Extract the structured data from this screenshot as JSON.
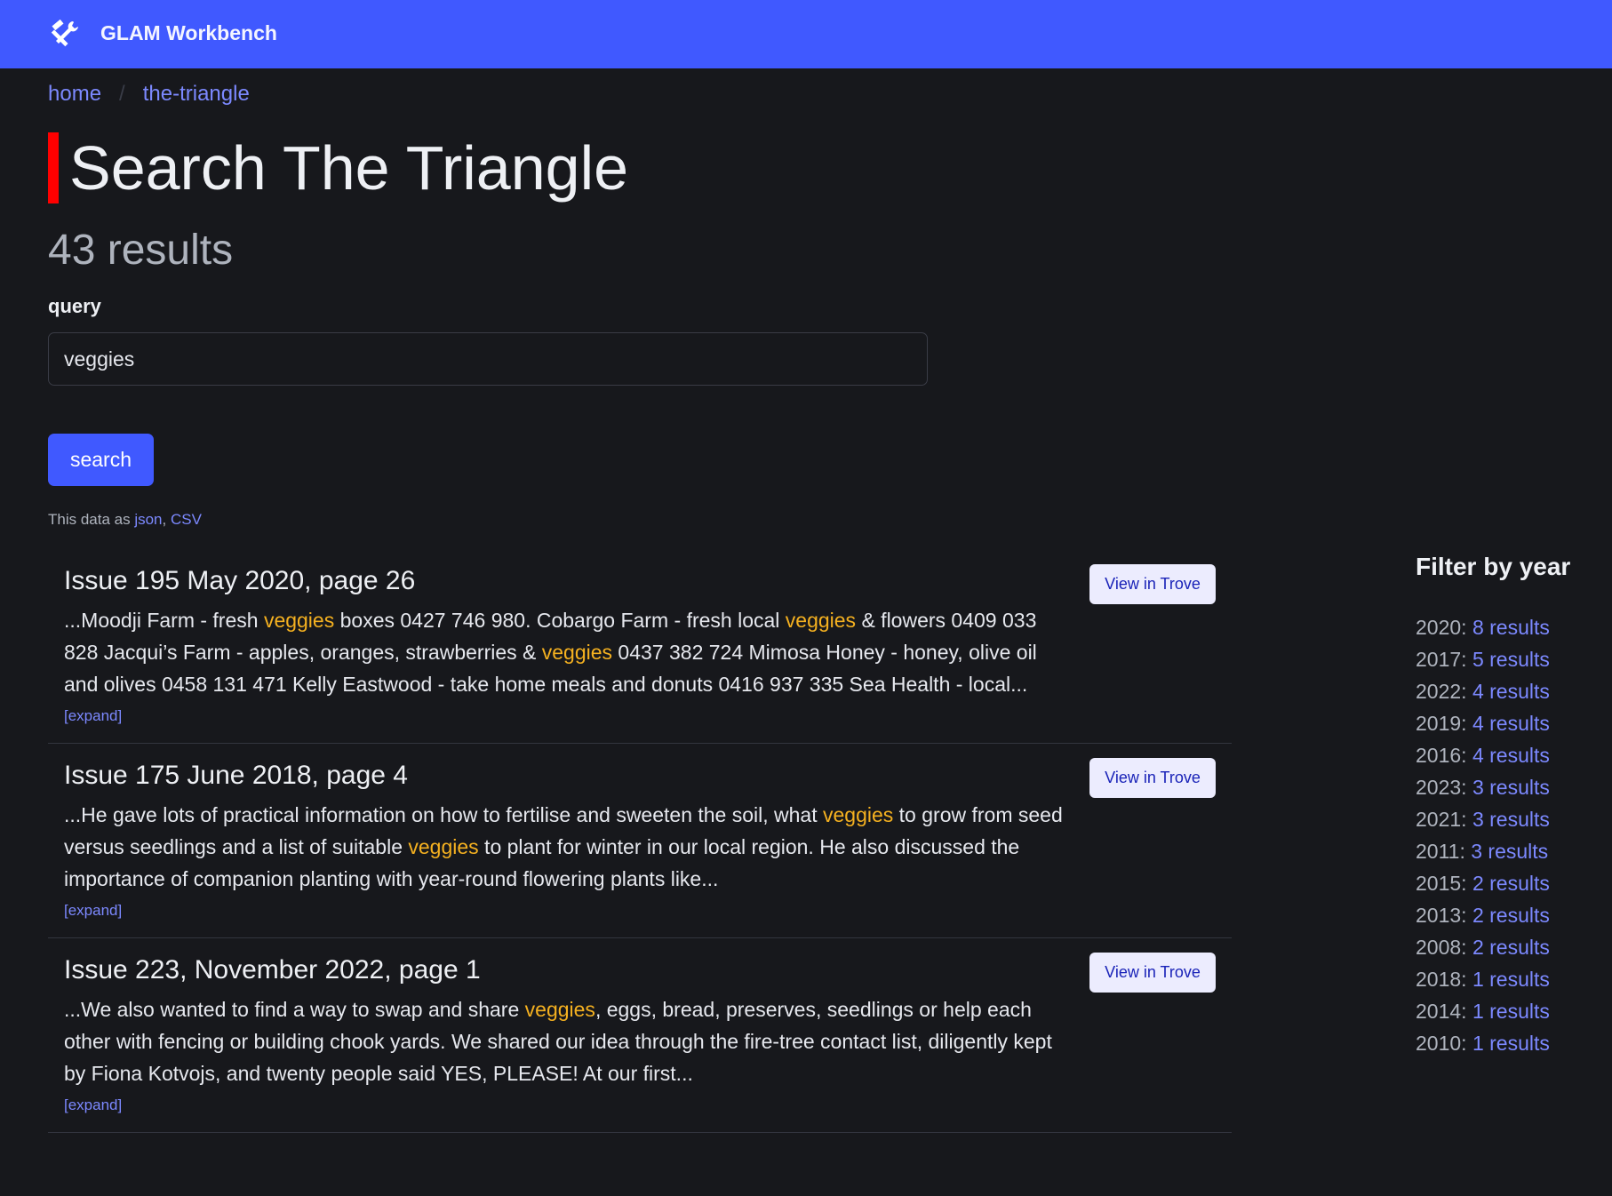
{
  "app": {
    "brand": "GLAM Workbench",
    "logo_icon": "tools-icon"
  },
  "breadcrumb": [
    {
      "label": "home"
    },
    {
      "label": "the-triangle"
    }
  ],
  "breadcrumb_separator": "/",
  "page": {
    "title": "Search The Triangle",
    "result_count": "43 results"
  },
  "search": {
    "label": "query",
    "value": "veggies",
    "button_label": "search"
  },
  "export": {
    "prefix": "This data as ",
    "json_label": "json",
    "separator": ", ",
    "csv_label": "CSV"
  },
  "colors": {
    "brand": "#4059ff",
    "background": "#17181c",
    "highlight": "#f5b120",
    "link": "#7c89ff",
    "title_accent": "#ff0000"
  },
  "results": [
    {
      "title": "Issue 195 May 2020, page 26",
      "button_label": "View in Trove",
      "expand_label": "[expand]",
      "snippet": [
        {
          "text": "...Moodji Farm - fresh ",
          "hl": false
        },
        {
          "text": "veggies",
          "hl": true
        },
        {
          "text": " boxes 0427 746 980. Cobargo Farm - fresh local ",
          "hl": false
        },
        {
          "text": "veggies",
          "hl": true
        },
        {
          "text": " & flowers 0409 033 828 Jacqui’s Farm - apples, oranges, strawberries & ",
          "hl": false
        },
        {
          "text": "veggies",
          "hl": true
        },
        {
          "text": " 0437 382 724 Mimosa Honey - honey, olive oil and olives 0458 131 471 Kelly Eastwood - take home meals and donuts 0416 937 335 Sea Health - local...",
          "hl": false
        }
      ]
    },
    {
      "title": "Issue 175 June 2018, page 4",
      "button_label": "View in Trove",
      "expand_label": "[expand]",
      "snippet": [
        {
          "text": "...He gave lots of practical information on how to fertilise and sweeten the soil, what ",
          "hl": false
        },
        {
          "text": "veggies",
          "hl": true
        },
        {
          "text": " to grow from seed versus seedlings and a list of suitable ",
          "hl": false
        },
        {
          "text": "veggies",
          "hl": true
        },
        {
          "text": " to plant for winter in our local region. He also discussed the importance of companion planting with year-round flowering plants like...",
          "hl": false
        }
      ]
    },
    {
      "title": "Issue 223, November 2022, page 1",
      "button_label": "View in Trove",
      "expand_label": "[expand]",
      "snippet": [
        {
          "text": "...We also wanted to find a way to swap and share ",
          "hl": false
        },
        {
          "text": "veggies",
          "hl": true
        },
        {
          "text": ", eggs, bread, preserves, seedlings or help each other with fencing or building chook yards. We shared our idea through the fire-tree contact list, diligently kept by Fiona Kotvojs, and twenty people said YES, PLEASE! At our first...",
          "hl": false
        }
      ]
    }
  ],
  "filter": {
    "heading": "Filter by year",
    "items": [
      {
        "year": "2020: ",
        "count": "8 results"
      },
      {
        "year": "2017: ",
        "count": "5 results"
      },
      {
        "year": "2022: ",
        "count": "4 results"
      },
      {
        "year": "2019: ",
        "count": "4 results"
      },
      {
        "year": "2016: ",
        "count": "4 results"
      },
      {
        "year": "2023: ",
        "count": "3 results"
      },
      {
        "year": "2021: ",
        "count": "3 results"
      },
      {
        "year": "2011: ",
        "count": "3 results"
      },
      {
        "year": "2015: ",
        "count": "2 results"
      },
      {
        "year": "2013: ",
        "count": "2 results"
      },
      {
        "year": "2008: ",
        "count": "2 results"
      },
      {
        "year": "2018: ",
        "count": "1 results"
      },
      {
        "year": "2014: ",
        "count": "1 results"
      },
      {
        "year": "2010: ",
        "count": "1 results"
      }
    ]
  }
}
